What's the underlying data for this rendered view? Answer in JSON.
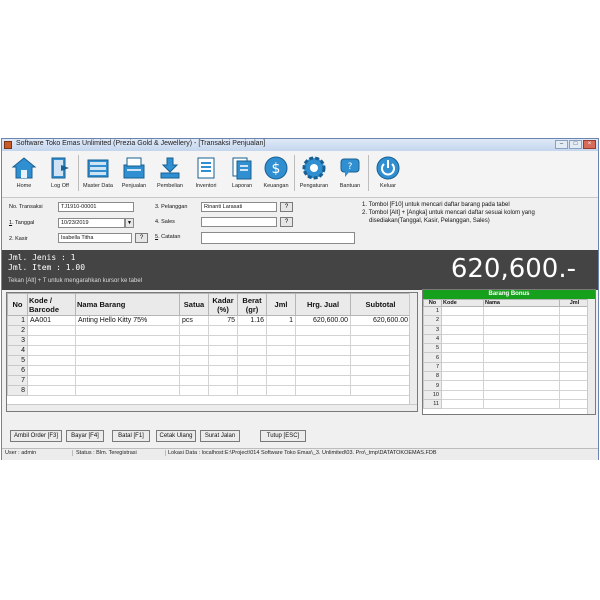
{
  "window": {
    "title": "Software Toko Emas Unlimited (Prezia Gold & Jewellery) - [Transaksi Penjualan]"
  },
  "toolbar": {
    "items": [
      {
        "label": "Home",
        "icon": "home-icon"
      },
      {
        "label": "Log Off",
        "icon": "logoff-icon"
      },
      {
        "label": "Master Data",
        "icon": "master-data-icon"
      },
      {
        "label": "Penjualan",
        "icon": "penjualan-icon"
      },
      {
        "label": "Pembelian",
        "icon": "pembelian-icon"
      },
      {
        "label": "Inventori",
        "icon": "inventori-icon"
      },
      {
        "label": "Laporan",
        "icon": "laporan-icon"
      },
      {
        "label": "Keuangan",
        "icon": "keuangan-icon"
      },
      {
        "label": "Pengaturan",
        "icon": "pengaturan-icon"
      },
      {
        "label": "Bantuan",
        "icon": "bantuan-icon"
      },
      {
        "label": "Keluar",
        "icon": "keluar-icon"
      }
    ]
  },
  "form": {
    "no_transaksi_label": "No. Transaksi",
    "no_transaksi_value": "TJ1910-00001",
    "tanggal_num": "1",
    "tanggal_label": ". Tanggal",
    "tanggal_value": "10/23/2019",
    "kasir_num": "2",
    "kasir_label": ". Kasir",
    "kasir_value": "Isabella Titha",
    "pelanggan_label": "3. Pelanggan",
    "pelanggan_value": "Rinanti Larasati",
    "sales_label": "4. Sales",
    "sales_value": "",
    "catatan_num": "5",
    "catatan_label": ". Catatan",
    "catatan_value": "",
    "lookup_btn": "?"
  },
  "notes": [
    "1. Tombol [F10] untuk mencari daftar barang pada tabel",
    "2. Tombol [Alt] + [Angka] untuk mencari daftar sesuai kolom yang",
    "disediakan(Tanggal, Kasir, Pelanggan, Sales)"
  ],
  "summary": {
    "jml_jenis": "Jml. Jenis : 1",
    "jml_item": "Jml. Item  : 1.00",
    "hint": "Tekan [Alt] + T untuk mengarahkan kursor ke tabel",
    "total": "620,600.-"
  },
  "items_table": {
    "headers": [
      "No",
      "Kode / Barcode",
      "Nama Barang",
      "Satua",
      "Kadar (%)",
      "Berat (gr)",
      "Jml",
      "Hrg. Jual",
      "Subtotal"
    ],
    "rows": [
      [
        "1",
        "AA001",
        "Anting Hello Kitty 75%",
        "pcs",
        "75",
        "1.16",
        "1",
        "620,600.00",
        "620,600.00"
      ],
      [
        "2",
        "",
        "",
        "",
        "",
        "",
        "",
        "",
        ""
      ],
      [
        "3",
        "",
        "",
        "",
        "",
        "",
        "",
        "",
        ""
      ],
      [
        "4",
        "",
        "",
        "",
        "",
        "",
        "",
        "",
        ""
      ],
      [
        "5",
        "",
        "",
        "",
        "",
        "",
        "",
        "",
        ""
      ],
      [
        "6",
        "",
        "",
        "",
        "",
        "",
        "",
        "",
        ""
      ],
      [
        "7",
        "",
        "",
        "",
        "",
        "",
        "",
        "",
        ""
      ],
      [
        "8",
        "",
        "",
        "",
        "",
        "",
        "",
        "",
        ""
      ]
    ]
  },
  "bonus_table": {
    "title": "Barang Bonus",
    "headers": [
      "No",
      "Kode",
      "Nama",
      "Jml"
    ],
    "rows": [
      "1",
      "2",
      "3",
      "4",
      "5",
      "6",
      "7",
      "8",
      "9",
      "10",
      "11"
    ]
  },
  "buttons": {
    "ambil_order": "Ambil Order [F3]",
    "bayar": "Bayar [F4]",
    "batal": "Batal [F1]",
    "cetak_ulang": "Cetak Ulang",
    "surat_jalan": "Surat Jalan",
    "tutup": "Tutup [ESC]"
  },
  "status": {
    "user": "User : admin",
    "status": "Status : Blm. Teregistrasi",
    "lokasi": "Lokasi Data : localhost:E:\\Project\\014 Software Toko Emas\\_3. Unlimited\\03. Pro\\_tmp\\DATATOKOEMAS.FDB"
  },
  "colors": {
    "summary_bg": "#444444",
    "bonus_header": "#16a01c",
    "toolbar_icon": "#2f8fd0"
  }
}
